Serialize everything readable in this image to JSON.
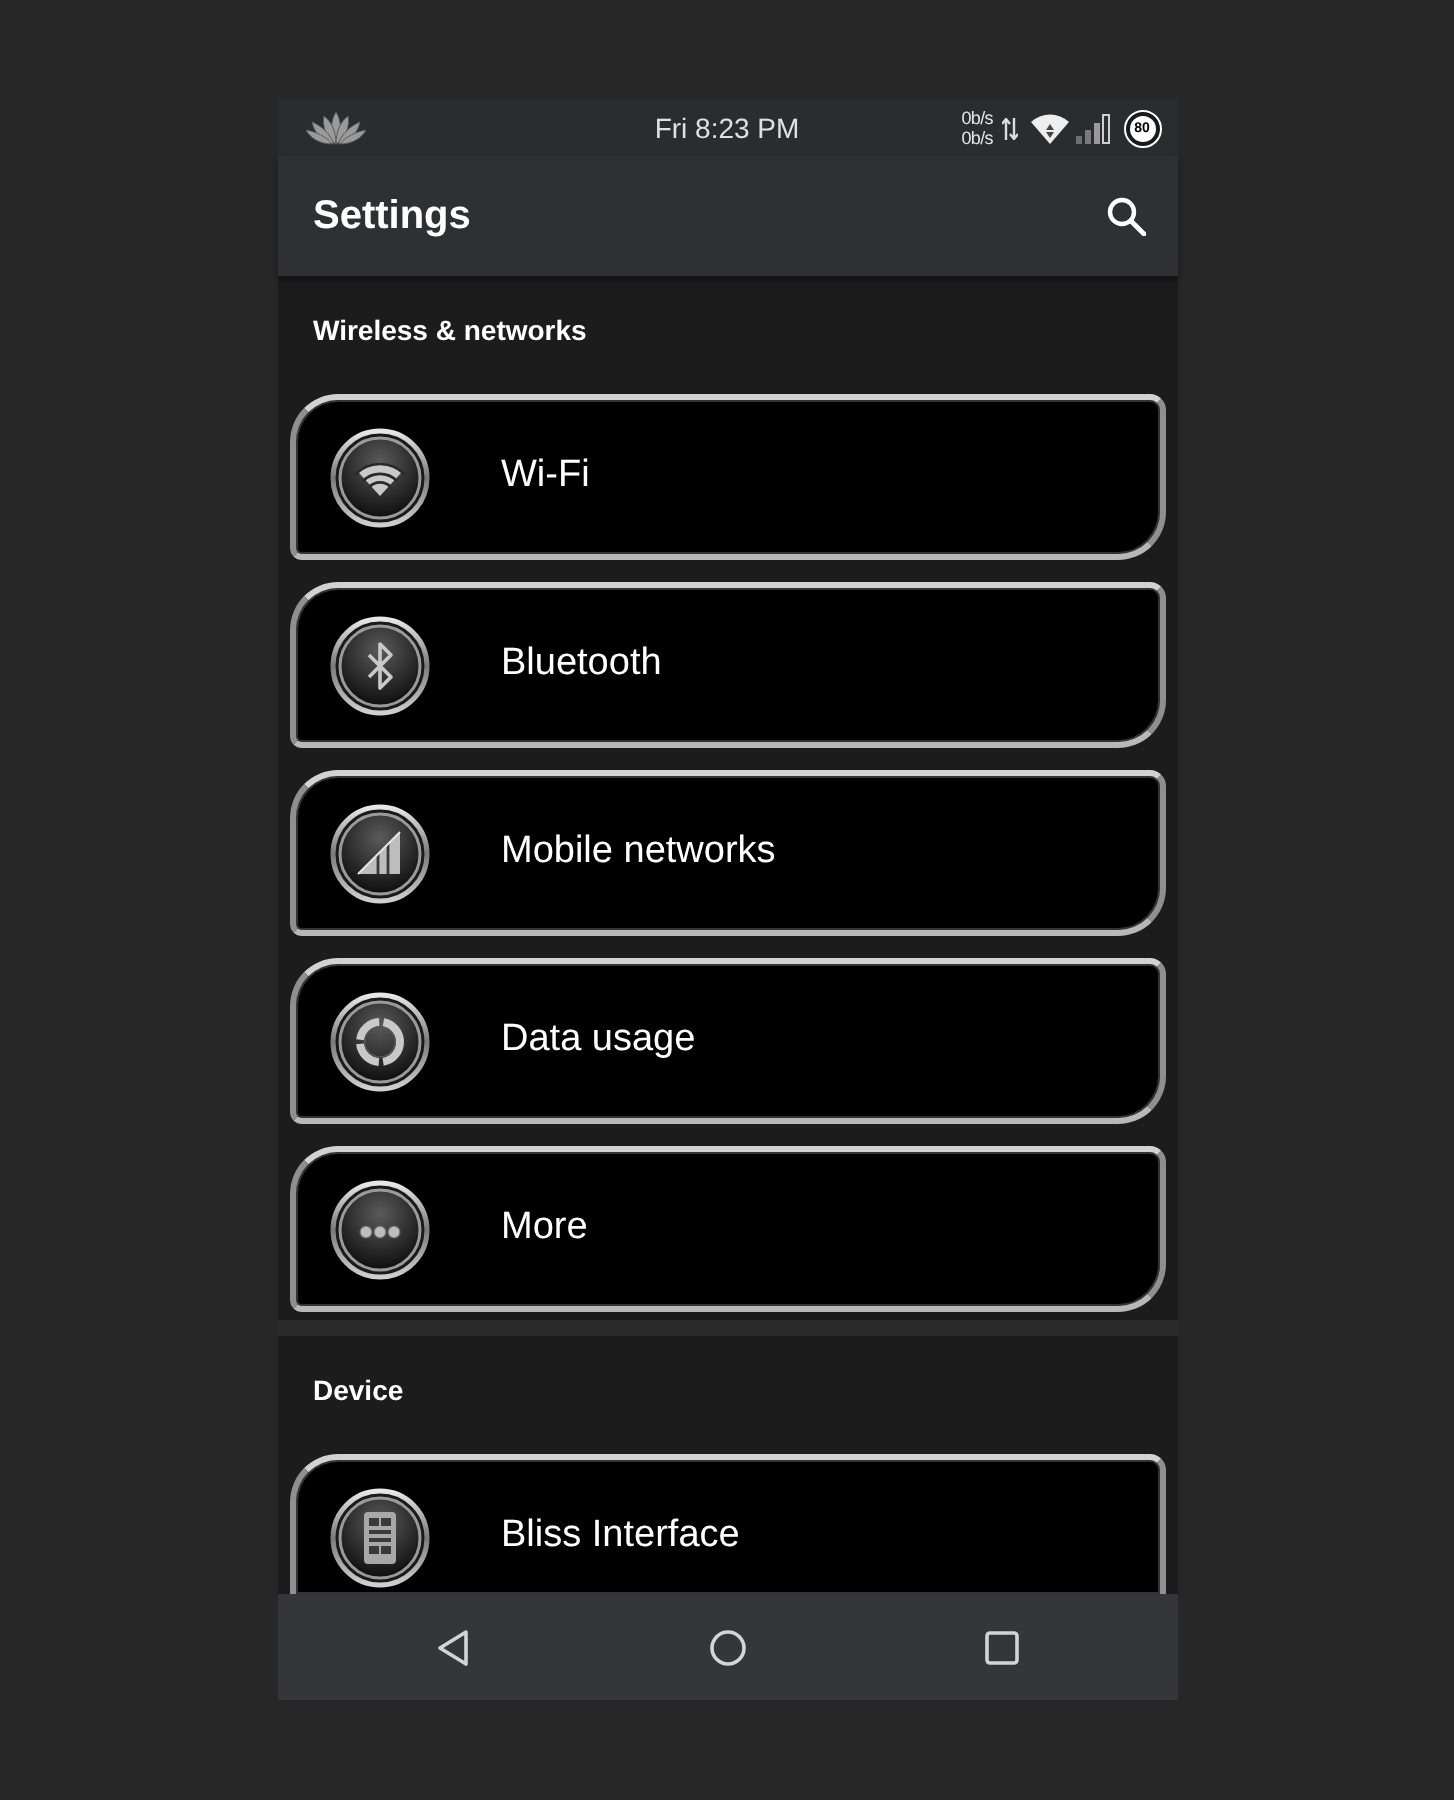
{
  "status_bar": {
    "time": "Fri 8:23 PM",
    "upload_rate": "0b/s",
    "download_rate": "0b/s",
    "battery": "80"
  },
  "app_bar": {
    "title": "Settings"
  },
  "sections": [
    {
      "title": "Wireless & networks",
      "items": [
        {
          "label": "Wi-Fi",
          "kind": "wifi"
        },
        {
          "label": "Bluetooth",
          "kind": "bluetooth"
        },
        {
          "label": "Mobile networks",
          "kind": "signal"
        },
        {
          "label": "Data usage",
          "kind": "ring"
        },
        {
          "label": "More",
          "kind": "more"
        }
      ]
    },
    {
      "title": "Device",
      "items": [
        {
          "label": "Bliss Interface",
          "kind": "layout"
        }
      ]
    }
  ]
}
